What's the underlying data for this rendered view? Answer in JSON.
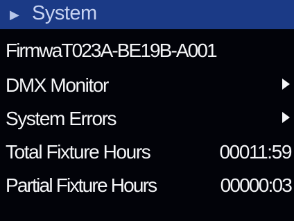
{
  "header": {
    "arrow_icon": "right-triangle-icon",
    "title": "System"
  },
  "menu": {
    "firmware": "FirmwaT023A-BE19B-A001",
    "dmx_monitor": "DMX Monitor",
    "system_errors": "System Errors",
    "total_fixture_hours_label": "Total Fixture Hours",
    "total_fixture_hours_value": "00011:59",
    "partial_fixture_hours_label": "Partial Fixture Hours",
    "partial_fixture_hours_value": "00000:03"
  },
  "colors": {
    "header_background": "#1b3a86",
    "header_text": "#c7d3f2",
    "screen_background": "#020309",
    "menu_text": "#f5f6f8"
  }
}
